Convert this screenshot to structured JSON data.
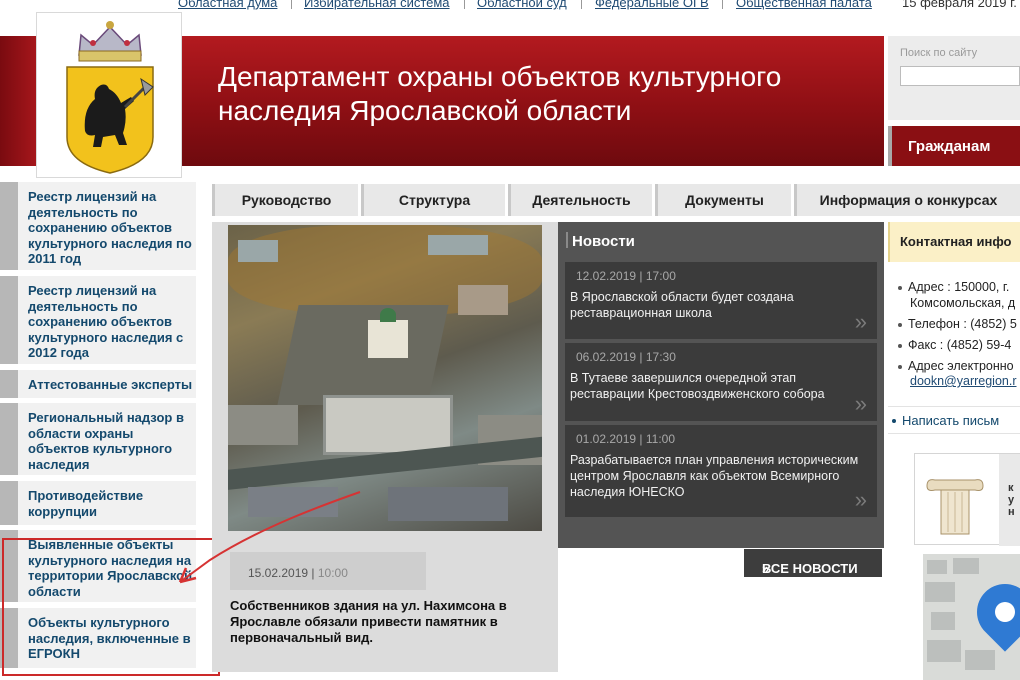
{
  "top_links": [
    "Областная дума",
    "Избирательная система",
    "Областной суд",
    "Федеральные ОГВ",
    "Общественная палата"
  ],
  "date": "15 февраля 2019 г.",
  "header": {
    "title_line1": "Департамент охраны объектов культурного",
    "title_line2": "наследия Ярославской области"
  },
  "search": {
    "placeholder": "Поиск по сайту"
  },
  "citizens_tab": "Гражданам",
  "sidebar": {
    "items": [
      "Реестр лицензий на деятельность по сохранению объектов культурного наследия по 2011 год",
      "Реестр лицензий на деятельность по сохранению объектов культурного наследия с 2012 года",
      "Аттестованные эксперты",
      "Региональный надзор в области охраны объектов культурного наследия",
      "Противодействие коррупции",
      "Выявленные объекты культурного наследия на территории Ярославской области",
      "Объекты культурного наследия, включенные в ЕГРОКН"
    ]
  },
  "nav": [
    "Руководство",
    "Структура",
    "Деятельность",
    "Документы",
    "Информация о конкурсах"
  ],
  "main_story": {
    "date": "15.02.2019",
    "time": "10:00",
    "title": "Собственников здания на ул. Нахимсона в Ярославле обязали привести памятник в первоначальный вид."
  },
  "news": {
    "header": "Новости",
    "items": [
      {
        "date": "12.02.2019",
        "time": "17:00",
        "text": "В Ярославской области будет создана реставрационная школа"
      },
      {
        "date": "06.02.2019",
        "time": "17:30",
        "text": "В Тутаеве завершился очередной этап реставрации Крестовоздвиженского собора"
      },
      {
        "date": "01.02.2019",
        "time": "11:00",
        "text": "Разрабатывается план управления историческим центром Ярославля как объектом Всемирного наследия ЮНЕСКО"
      }
    ],
    "all_label": "ВСЕ НОВОСТИ",
    "separator": "|",
    "arrow_glyph": "»"
  },
  "contacts": {
    "header": "Контактная инфо",
    "address_label": "Адрес : 150000, г.",
    "address_cont": "Комсомольская, д",
    "phone": "Телефон : (4852) 5",
    "fax": "Факс : (4852) 59-4",
    "email_label": "Адрес электронно",
    "email": "dookn@yarregion.r",
    "write": "Написать письм"
  },
  "banner_text": "к\nу\nн",
  "colors": {
    "header_red": "#8e0f14",
    "nav_bg": "#e8e8e8",
    "news_bg": "#545454",
    "link_blue": "#14496d",
    "highlight_red": "#cc2a2a"
  }
}
